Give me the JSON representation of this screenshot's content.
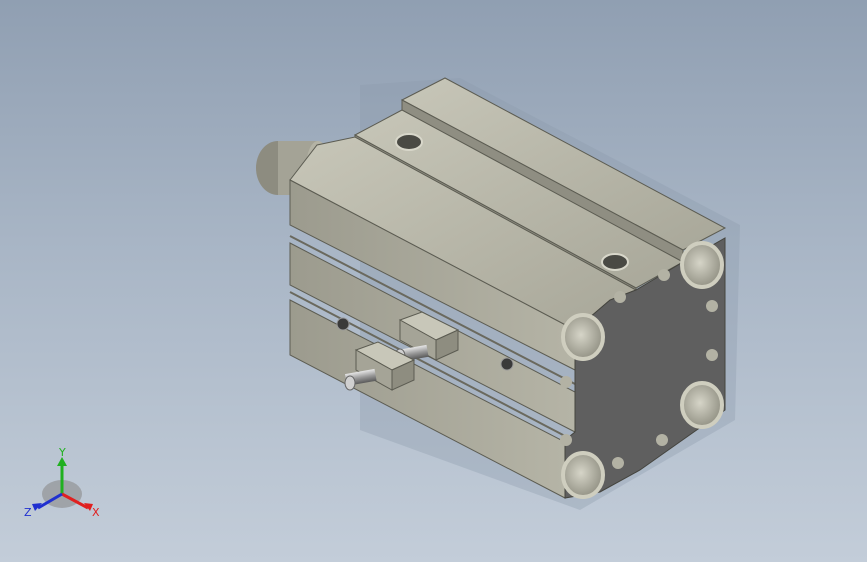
{
  "viewport": {
    "background_top": "#909fb2",
    "background_bottom": "#c3cdd9"
  },
  "model": {
    "name": "compact-pneumatic-cylinder",
    "body_color": "#b3b2a4",
    "face_color": "#5f5f5f"
  },
  "triad": {
    "x_label": "X",
    "y_label": "Y",
    "z_label": "Z",
    "x_color": "#e02020",
    "y_color": "#20b020",
    "z_color": "#2030d0"
  }
}
